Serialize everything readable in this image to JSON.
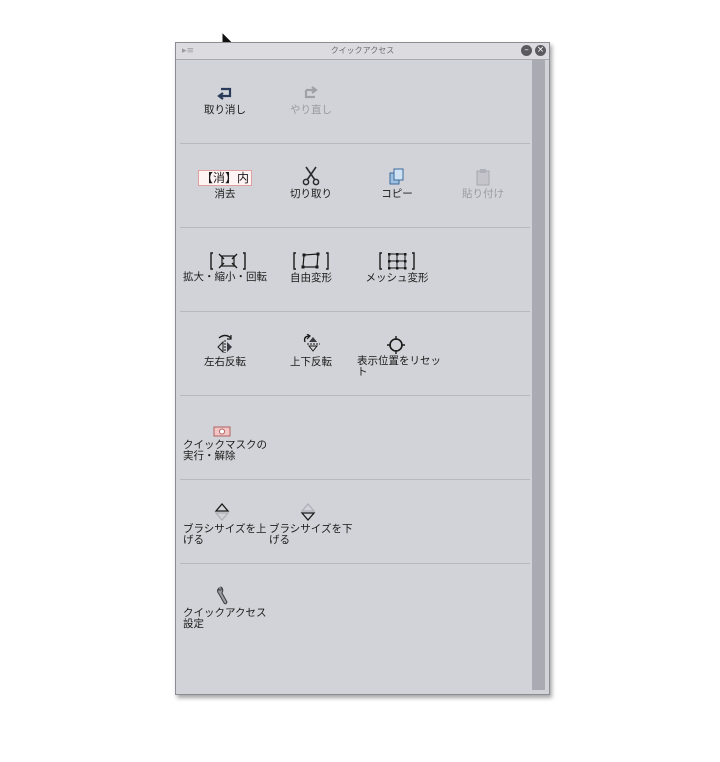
{
  "panel": {
    "title": "クイックアクセス",
    "rows": [
      [
        {
          "label": "取り消し",
          "icon": "undo-icon",
          "disabled": false
        },
        {
          "label": "やり直し",
          "icon": "redo-icon",
          "disabled": true
        }
      ],
      [
        {
          "label": "消去",
          "icon": "clear-icon",
          "icon_text": "【消】内",
          "disabled": false
        },
        {
          "label": "切り取り",
          "icon": "scissors-icon",
          "disabled": false
        },
        {
          "label": "コピー",
          "icon": "copy-icon",
          "disabled": false
        },
        {
          "label": "貼り付け",
          "icon": "paste-icon",
          "disabled": true
        }
      ],
      [
        {
          "label": "拡大・縮小・回転",
          "icon": "scale-rotate-icon",
          "disabled": false
        },
        {
          "label": "自由変形",
          "icon": "free-transform-icon",
          "disabled": false
        },
        {
          "label": "メッシュ変形",
          "icon": "mesh-transform-icon",
          "disabled": false
        }
      ],
      [
        {
          "label": "左右反転",
          "icon": "flip-horizontal-icon",
          "disabled": false
        },
        {
          "label": "上下反転",
          "icon": "flip-vertical-icon",
          "disabled": false
        },
        {
          "label": "表示位置をリセット",
          "icon": "reset-position-icon",
          "disabled": false
        }
      ],
      [
        {
          "label": "クイックマスクの実行・解除",
          "icon": "quick-mask-icon",
          "disabled": false
        }
      ],
      [
        {
          "label": "ブラシサイズを上げる",
          "icon": "brush-size-up-icon",
          "disabled": false
        },
        {
          "label": "ブラシサイズを下げる",
          "icon": "brush-size-down-icon",
          "disabled": false
        }
      ],
      [
        {
          "label": "クイックアクセス設定",
          "icon": "wrench-icon",
          "disabled": false
        }
      ]
    ]
  }
}
